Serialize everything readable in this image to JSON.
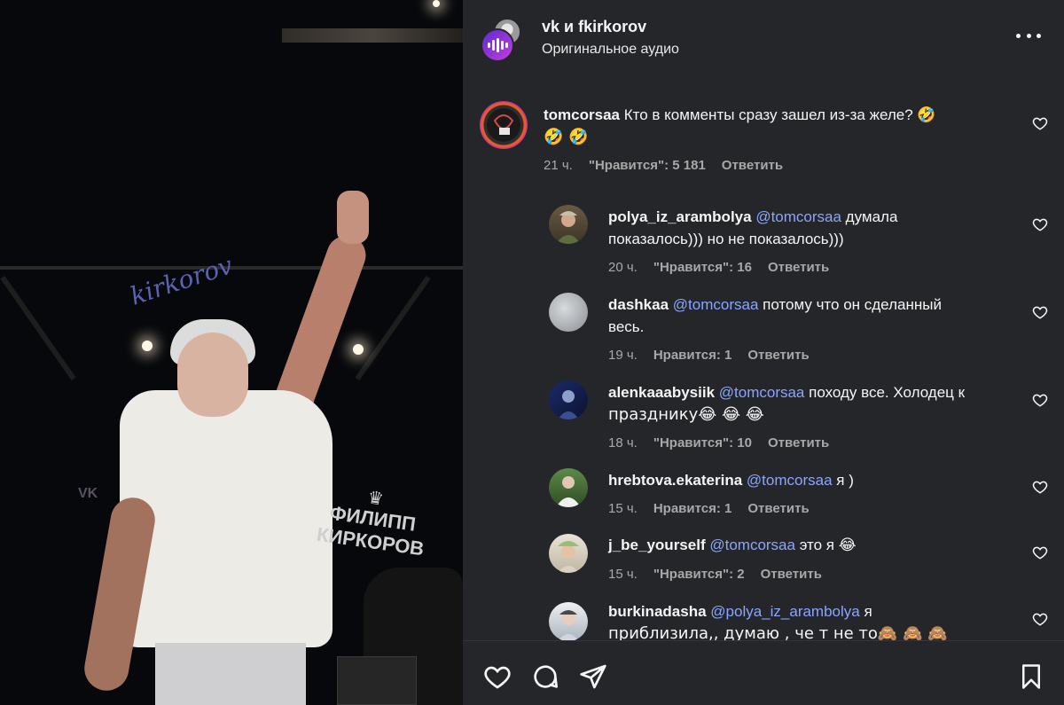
{
  "header": {
    "title": "vk и fkirkorov",
    "subtitle": "Оригинальное аудио",
    "more_icon": "more-horizontal-icon"
  },
  "media": {
    "banner_line1": "ФИЛИПП",
    "banner_line2": "КИРКОРОВ",
    "shirt_text": "kirkorov",
    "badge_text": "VK"
  },
  "comments": [
    {
      "user": "tomcorsaa",
      "mention": "",
      "text": "Кто в комменты сразу зашел из-за желе? 🤣",
      "text2": "🤣 🤣",
      "time": "21 ч.",
      "likes": "\"Нравится\": 5 181",
      "reply": "Ответить"
    },
    {
      "user": "polya_iz_arambolya",
      "mention": "@tomcorsaa",
      "text": " думала",
      "text2": "показалось))) но не показалось)))",
      "time": "20 ч.",
      "likes": "\"Нравится\": 16",
      "reply": "Ответить"
    },
    {
      "user": "dashkaa",
      "mention": "@tomcorsaa",
      "text": " потому что он сделанный",
      "text2": "весь.",
      "time": "19 ч.",
      "likes": "Нравится: 1",
      "reply": "Ответить"
    },
    {
      "user": "alenkaaabysiik",
      "mention": "@tomcorsaa",
      "text": " походу все. Холодец к",
      "text2": "празднику😂 😂 😂",
      "time": "18 ч.",
      "likes": "\"Нравится\": 10",
      "reply": "Ответить"
    },
    {
      "user": "hrebtova.ekaterina",
      "mention": "@tomcorsaa",
      "text": " я )",
      "text2": "",
      "time": "15 ч.",
      "likes": "Нравится: 1",
      "reply": "Ответить"
    },
    {
      "user": "j_be_yourself",
      "mention": "@tomcorsaa",
      "text": " это я 😂",
      "text2": "",
      "time": "15 ч.",
      "likes": "\"Нравится\": 2",
      "reply": "Ответить"
    },
    {
      "user": "burkinadasha",
      "mention": "@polya_iz_arambolya",
      "text": " я",
      "text2": "приблизила,, думаю , че т не то🙈 🙈 🙈",
      "time": "",
      "likes": "",
      "reply": ""
    }
  ],
  "footer": {
    "icons": [
      "heart-icon",
      "comment-icon",
      "share-icon",
      "bookmark-icon"
    ]
  },
  "colors": {
    "panel_bg": "#25262a",
    "mention": "#8aa5ff",
    "meta": "#a8a8a8"
  }
}
